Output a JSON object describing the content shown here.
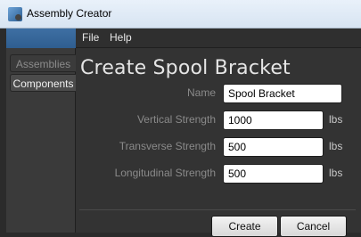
{
  "window": {
    "title": "Assembly Creator"
  },
  "menu": {
    "items": [
      "File",
      "Help"
    ]
  },
  "sidebar": {
    "tabs": [
      "Assemblies",
      "Components"
    ],
    "selected": "Components"
  },
  "form": {
    "title": "Create Spool Bracket",
    "fields": [
      {
        "label": "Name",
        "value": "Spool Bracket",
        "unit": ""
      },
      {
        "label": "Vertical Strength",
        "value": "1000",
        "unit": "lbs"
      },
      {
        "label": "Transverse Strength",
        "value": "500",
        "unit": "lbs"
      },
      {
        "label": "Longitudinal Strength",
        "value": "500",
        "unit": "lbs"
      }
    ],
    "buttons": {
      "create": "Create",
      "cancel": "Cancel"
    }
  },
  "colors": {
    "background": "#333333",
    "titlebar": "#dce8f5",
    "sidebar_accent": "#3e6fa3",
    "label_text": "#8a8a8a"
  }
}
